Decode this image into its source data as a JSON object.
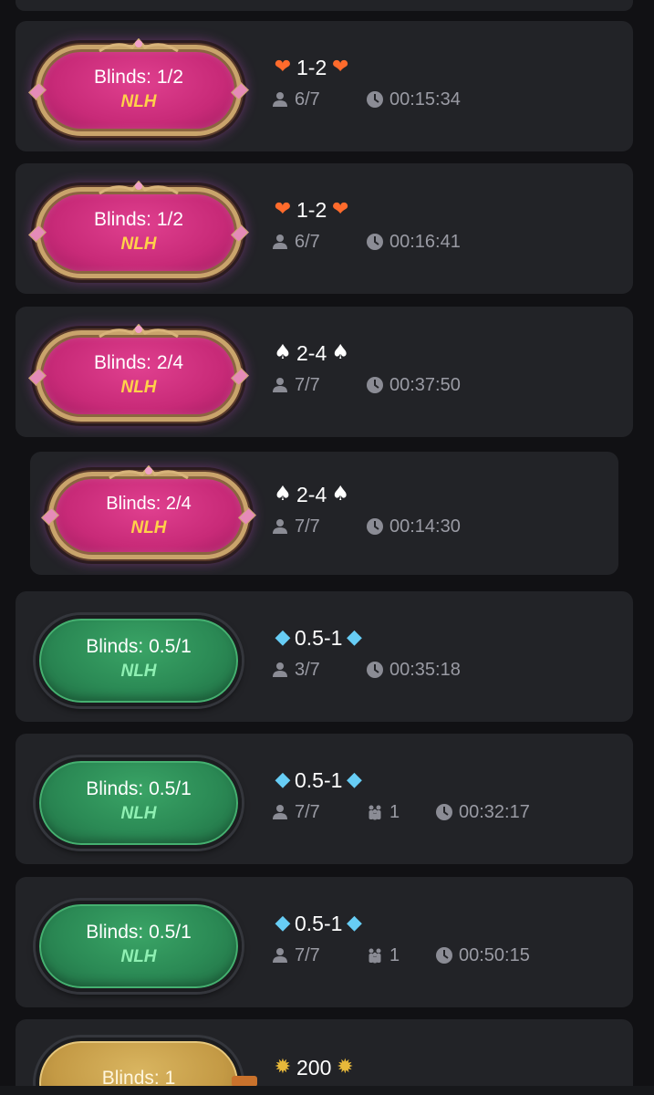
{
  "tables": [
    {
      "blinds": "Blinds: 1/2",
      "game": "NLH",
      "name": "1-2",
      "emoji": "❤",
      "emoji_name": "heart-on-fire-icon",
      "players": "6/7",
      "time": "00:15:34",
      "theme": "pink"
    },
    {
      "blinds": "Blinds: 1/2",
      "game": "NLH",
      "name": "1-2",
      "emoji": "❤",
      "emoji_name": "heart-on-fire-icon",
      "players": "6/7",
      "time": "00:16:41",
      "theme": "pink"
    },
    {
      "blinds": "Blinds: 2/4",
      "game": "NLH",
      "name": "2-4",
      "emoji": "♠",
      "emoji_name": "spade-icon",
      "players": "7/7",
      "time": "00:37:50",
      "theme": "pink"
    },
    {
      "blinds": "Blinds: 2/4",
      "game": "NLH",
      "name": "2-4",
      "emoji": "♠",
      "emoji_name": "spade-icon",
      "players": "7/7",
      "time": "00:14:30",
      "theme": "pink"
    },
    {
      "blinds": "Blinds: 0.5/1",
      "game": "NLH",
      "name": "0.5-1",
      "emoji": "◆",
      "emoji_name": "diamond-gem-icon",
      "players": "3/7",
      "time": "00:35:18",
      "theme": "green"
    },
    {
      "blinds": "Blinds: 0.5/1",
      "game": "NLH",
      "name": "0.5-1",
      "emoji": "◆",
      "emoji_name": "diamond-gem-icon",
      "players": "7/7",
      "waiting": "1",
      "time": "00:32:17",
      "theme": "green"
    },
    {
      "blinds": "Blinds: 0.5/1",
      "game": "NLH",
      "name": "0.5-1",
      "emoji": "◆",
      "emoji_name": "diamond-gem-icon",
      "players": "7/7",
      "waiting": "1",
      "time": "00:50:15",
      "theme": "green"
    },
    {
      "blinds": "Blinds: 1",
      "name": "200",
      "emoji": "✹",
      "emoji_name": "pineapple-icon",
      "theme": "gold"
    }
  ],
  "colors": {
    "background": "#111114",
    "card": "#222327",
    "pink_badge": "#c82a78",
    "green_badge": "#2b8a55",
    "gold_badge": "#c49a45",
    "game_text_pink": "#ffd14a",
    "game_text_green": "#8ff0b3",
    "muted_text": "#9a9ba4"
  },
  "icons": {
    "players": "person-icon",
    "waiting": "group-icon",
    "time": "clock-icon"
  }
}
